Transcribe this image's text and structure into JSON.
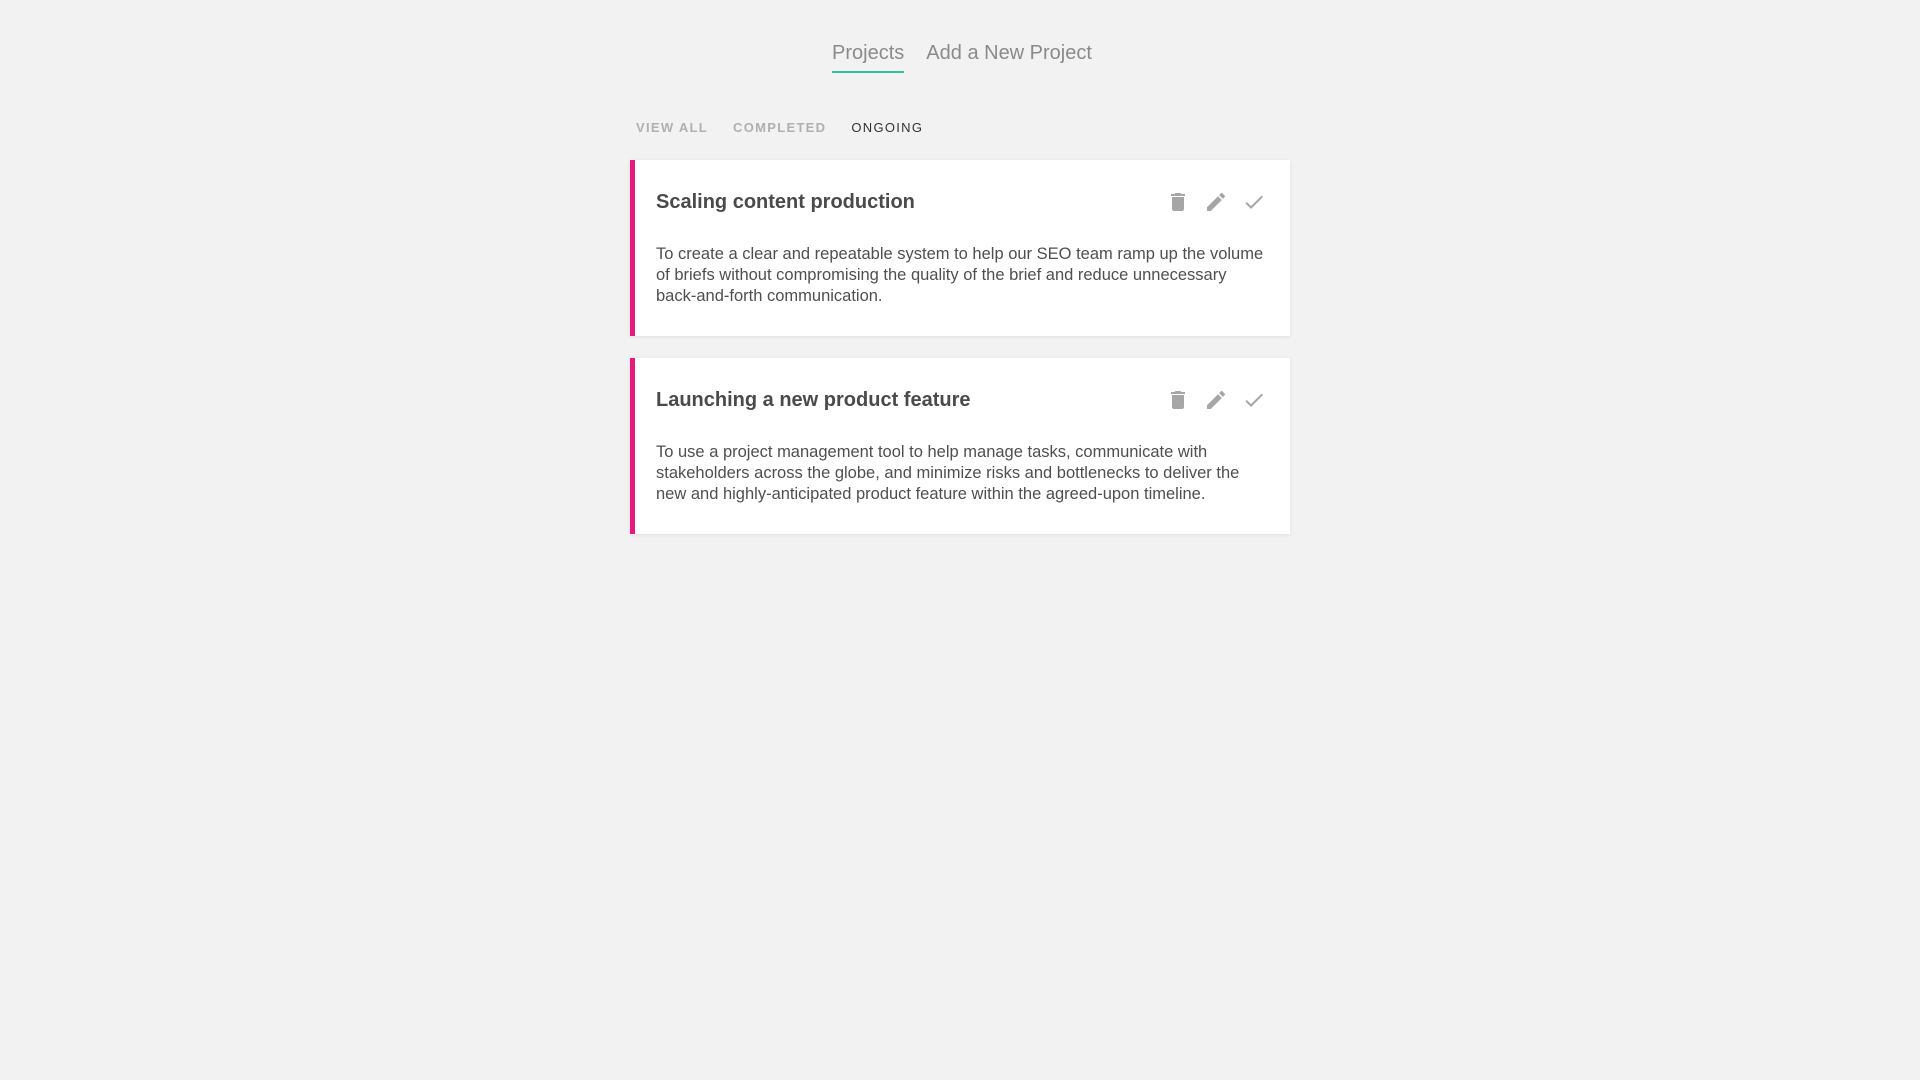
{
  "nav": {
    "projects_label": "Projects",
    "add_label": "Add a New Project"
  },
  "filters": {
    "view_all": "VIEW ALL",
    "completed": "COMPLETED",
    "ongoing": "ONGOING",
    "selected": "ongoing"
  },
  "colors": {
    "accent": "#2ec4a0",
    "card_border": "#e6197c",
    "background": "#f2f2f2"
  },
  "projects": [
    {
      "title": "Scaling content production",
      "description": "To create a clear and repeatable system to help our SEO team ramp up the volume of briefs without compromising the quality of the brief and reduce unnecessary back-and-forth communication.",
      "icons": [
        "trash-icon",
        "pencil-icon",
        "check-icon"
      ]
    },
    {
      "title": "Launching a new product feature",
      "description": "To use a project management tool to help manage tasks, communicate with stakeholders across the globe, and minimize risks and bottlenecks to deliver the new and highly-anticipated product feature within the agreed-upon timeline.",
      "icons": [
        "trash-icon",
        "pencil-icon",
        "check-icon"
      ]
    }
  ]
}
